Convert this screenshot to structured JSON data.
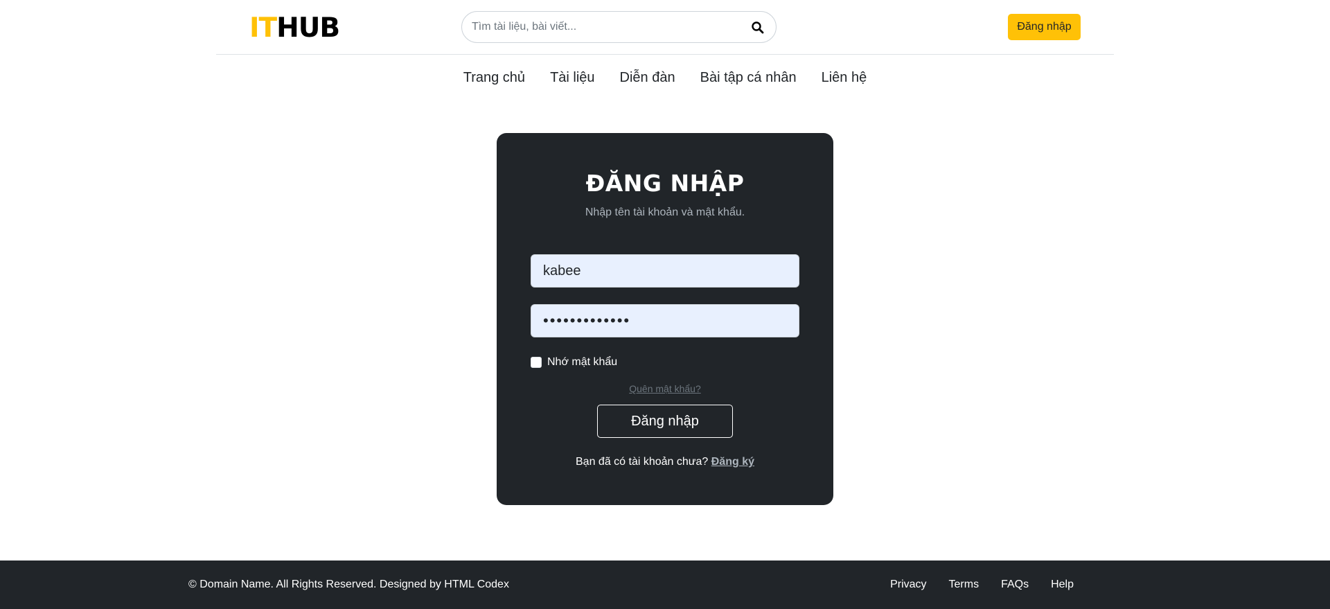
{
  "header": {
    "logo_it": "IT",
    "logo_hub": "HUB",
    "search_placeholder": "Tìm tài liệu, bài viết...",
    "login_button": "Đăng nhập"
  },
  "nav": {
    "items": [
      {
        "label": "Trang chủ"
      },
      {
        "label": "Tài liệu"
      },
      {
        "label": "Diễn đàn"
      },
      {
        "label": "Bài tập cá nhân"
      },
      {
        "label": "Liên hệ"
      }
    ]
  },
  "login": {
    "title": "ĐĂNG NHẬP",
    "subtitle": "Nhập tên tài khoản và mật khẩu.",
    "username_value": "kabee",
    "password_value": "•••••••••••••",
    "remember_label": "Nhớ mật khẩu",
    "remember_checked": false,
    "forgot_link": "Quên mật khẩu?",
    "submit_label": "Đăng nhập",
    "register_prompt": "Bạn đã có tài khoản chưa?",
    "register_link": "Đăng ký"
  },
  "footer": {
    "copyright": "© Domain Name. All Rights Reserved. Designed by HTML Codex",
    "links": [
      {
        "label": "Privacy"
      },
      {
        "label": "Terms"
      },
      {
        "label": "FAQs"
      },
      {
        "label": "Help"
      }
    ]
  },
  "colors": {
    "accent": "#ffc107",
    "dark": "#212529",
    "input_bg": "#e8f0fe"
  }
}
